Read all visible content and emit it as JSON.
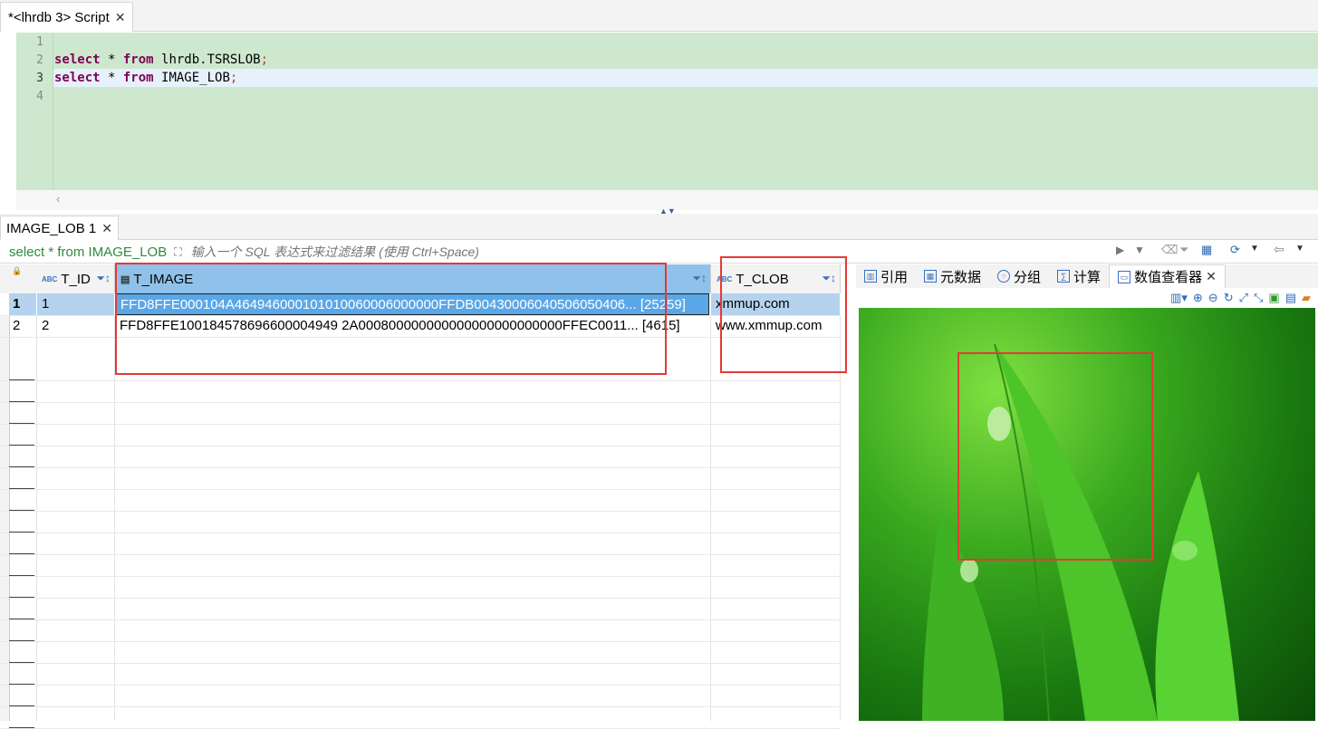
{
  "editor_tab": {
    "label": "*<lhrdb 3> Script"
  },
  "editor": {
    "line_numbers": [
      "1",
      "2",
      "3",
      "4"
    ],
    "line2": {
      "kw1": "select",
      "mid": " * ",
      "kw2": "from",
      "rest": " lhrdb.TSRSLOB",
      "semi": ";"
    },
    "line3": {
      "kw1": "select",
      "mid": " * ",
      "kw2": "from",
      "rest": " IMAGE_LOB",
      "semi": ";"
    }
  },
  "results_tab": {
    "label": "IMAGE_LOB 1"
  },
  "filter": {
    "query": "select * from IMAGE_LOB",
    "placeholder": "输入一个 SQL 表达式来过滤结果 (使用 Ctrl+Space)"
  },
  "columns": {
    "id": "T_ID",
    "image": "T_IMAGE",
    "clob": "T_CLOB"
  },
  "rows": [
    {
      "num": "1",
      "id": "1",
      "image": "FFD8FFE000104A464946000101010060006000000FFDB0043000604050605040​6...",
      "size": "[25259]",
      "clob": "xmmup.com"
    },
    {
      "num": "2",
      "id": "2",
      "image": "FFD8FFE100184578696600004949 2A000800000000000000000000000FFEC0011...",
      "size": "[4615]",
      "clob": "www.xmmup.com"
    }
  ],
  "panel_tabs": [
    "引用",
    "元数据",
    "分组",
    "计算",
    "数值查看器"
  ],
  "colors": {
    "editor_bg": "#cde8cf",
    "keyword": "#7f0055",
    "selected_header": "#8fc1ea",
    "highlight_box": "#e53935"
  }
}
